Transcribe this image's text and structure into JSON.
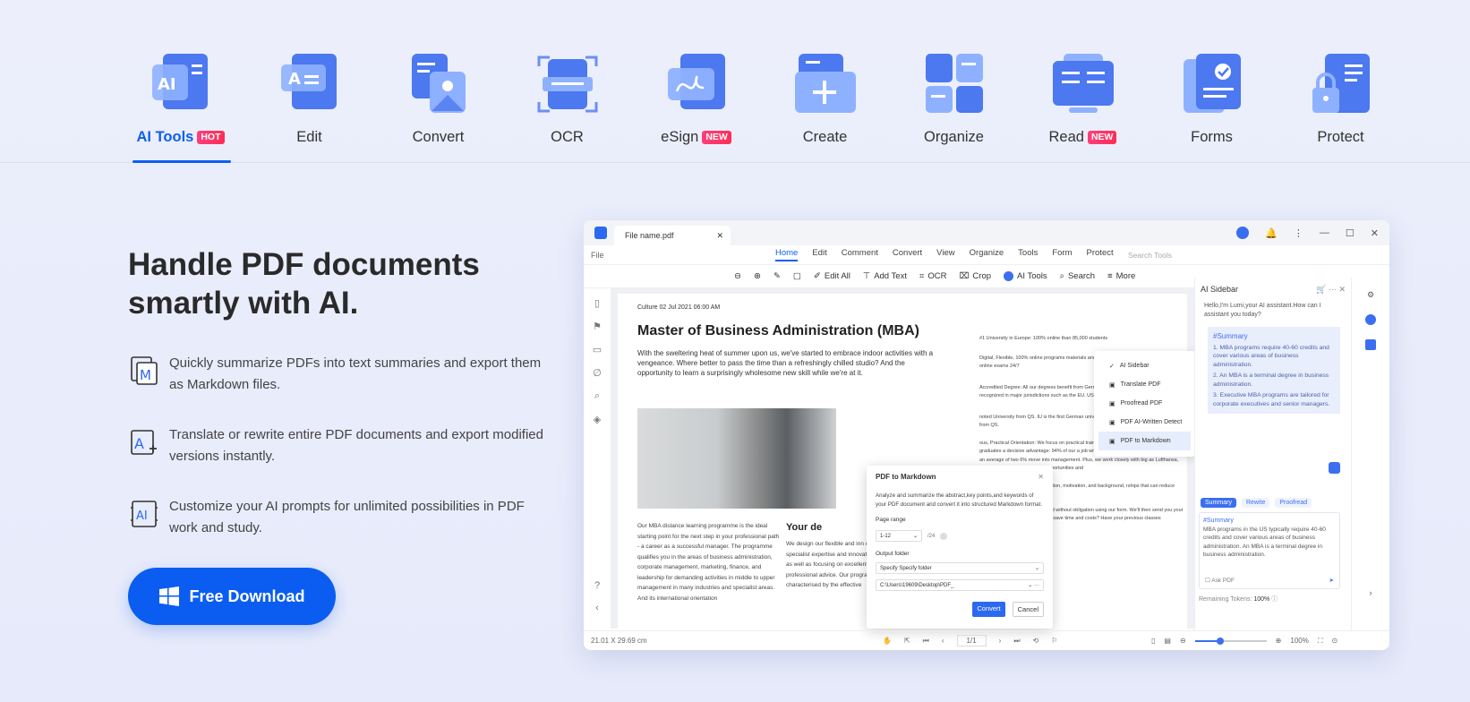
{
  "tabs": [
    {
      "label": "AI Tools",
      "badge": "HOT",
      "icon": "ai-tools-icon"
    },
    {
      "label": "Edit",
      "badge": "",
      "icon": "edit-icon"
    },
    {
      "label": "Convert",
      "badge": "",
      "icon": "convert-icon"
    },
    {
      "label": "OCR",
      "badge": "",
      "icon": "ocr-icon"
    },
    {
      "label": "eSign",
      "badge": "NEW",
      "icon": "esign-icon"
    },
    {
      "label": "Create",
      "badge": "",
      "icon": "create-icon"
    },
    {
      "label": "Organize",
      "badge": "",
      "icon": "organize-icon"
    },
    {
      "label": "Read",
      "badge": "NEW",
      "icon": "read-icon"
    },
    {
      "label": "Forms",
      "badge": "",
      "icon": "forms-icon"
    },
    {
      "label": "Protect",
      "badge": "",
      "icon": "protect-icon"
    }
  ],
  "hero": {
    "title": "Handle PDF documents smartly with AI.",
    "download": "Free Download"
  },
  "features": [
    {
      "text": "Quickly summarize PDFs into text summaries and export them as Markdown files.",
      "icon": "markdown-icon"
    },
    {
      "text": "Translate or rewrite entire PDF documents and export modified versions instantly.",
      "icon": "translate-icon"
    },
    {
      "text": "Customize your AI prompts for unlimited possibilities in PDF work and study.",
      "icon": "ai-prompt-icon"
    }
  ],
  "app": {
    "filename": "File name.pdf",
    "file": "File",
    "menus": [
      "Home",
      "Edit",
      "Comment",
      "Convert",
      "View",
      "Organize",
      "Tools",
      "Form",
      "Protect"
    ],
    "search_tools": "Search Tools",
    "toolbar": {
      "edit_all": "Edit All",
      "add_text": "Add Text",
      "ocr": "OCR",
      "crop": "Crop",
      "ai_tools": "AI Tools",
      "search": "Search",
      "more": "More"
    },
    "dropdown": [
      "AI Sidebar",
      "Translate PDF",
      "Proofread PDF",
      "PDF AI-Written Detect",
      "PDF to Markdown"
    ],
    "doc": {
      "time": "Culture 02 Jul 2021 06:00 AM",
      "title": "Master of Business Administration (MBA)",
      "para": "With the sweltering heat of summer upon us, we've started to embrace indoor activities with a vengeance. Where better to pass the time than a refreshingly chilled studio? And the opportunity to learn a surprisingly wholesome new skill while we're at it.",
      "col1": "Our MBA distance learning programme is the ideal starting point for the next step in your professional path - a career as a successful manager. The programme qualifies you in the areas of business administration, corporate management, marketing, finance, and leadership for demanding activities in middle to upper management in many industries and specialist areas. And its international orientation",
      "heading2": "Your de",
      "col2": "We design our flexible and inn quality. We deliver specialist expertise and innovative learning materials as well as focusing on excellent student services and professional advice. Our programmes are characterised by the effective",
      "col3a": "#1 University in Europe: 100% online than 85,000 students",
      "col3b": "Digital, Flexible, 100% online programs materials and a great online wherever you are with online exams 24/7",
      "col3c": "Accredited Degree: All our degrees benefit from German state accreditation internationally recognized in major jurisdictions such as the EU, US and",
      "col3d": "noted University from QS. IU is the first German university that ratings for Online Learning from QS.",
      "col3e": "ous, Practical Orientation: We focus on practical training and on outlook which gives IU graduates a decisive advantage: 94% of our a job within six months of graduation and, after an average of two 6% move into management. Plus, we work closely with big as Lufthansa, Sixt, and EY to give you great opportunities and",
      "col3f": "vailable: Depending on your situation, motivation, and background, rships that can reduce your tuition fees by up to 80%.",
      "col3g": "Secure your place at IU easily and without obligation using our form. We'll then send you your study agreement. Do you want to save time and costs? Have your previous classes recognised!"
    },
    "dialog": {
      "title": "PDF to Markdown",
      "desc": "Analyze and summarize the abstract,key points,and keywords of your PDF document and convert it into structured Markdown format.",
      "page_range": "Page range",
      "range_value": "1-12",
      "total": "/24",
      "output": "Output folder",
      "folder_opt": "Specify Specify folder",
      "path": "C:\\Users\\19609\\Desktop\\PDF_",
      "convert": "Convert",
      "cancel": "Cancel"
    },
    "sidebar": {
      "title": "AI Sidebar",
      "greeting": "Hello,I'm Lumi,your AI assistant.How can I assistant you today?",
      "summary_tag": "#Summary",
      "points": [
        "1. MBA programs require 40-60 credits and cover various areas of business administration.",
        "2. An MBA is a terminal degree in business administration.",
        "3. Executive MBA programs are tailored for corporate executives and senior managers."
      ],
      "chips": [
        "Summary",
        "Rewite",
        "Proofread"
      ],
      "input_tag": "#Summary",
      "input_text": "MBA programs in the US typically require 40-60 credits and cover various areas of business administration. An MBA is a terminal degree in business administration.",
      "ask": "Ask PDF",
      "tokens_label": "Remaining Tokens:",
      "tokens": "100%"
    },
    "status": {
      "size": "21.01 X 29.69 cm",
      "page": "1/1",
      "zoom": "100%",
      "zoom_fraction": 0.35
    }
  },
  "colors": {
    "accent": "#0b5ff0",
    "badge": "#ff2d55"
  }
}
